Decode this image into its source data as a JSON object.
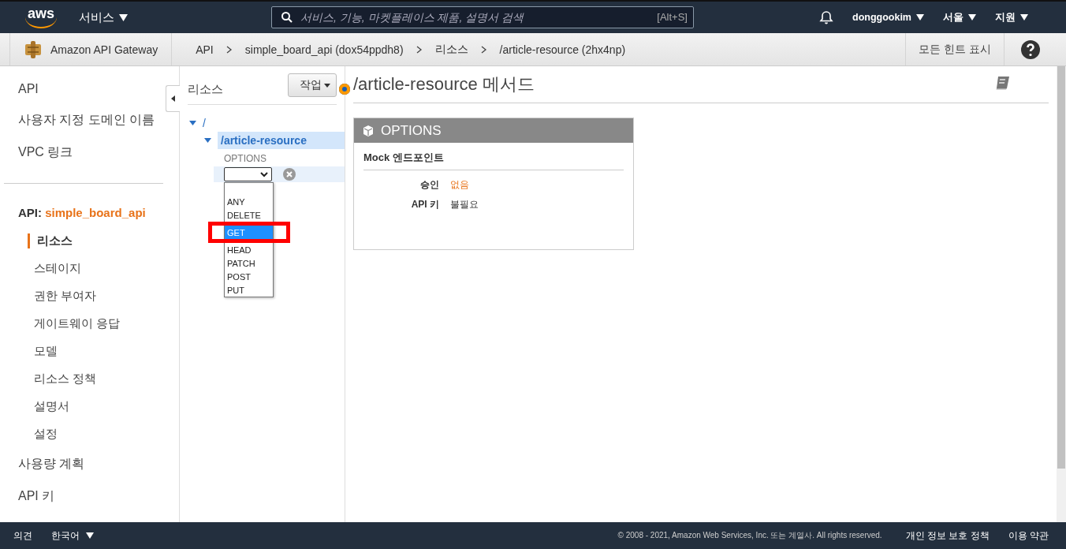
{
  "top_nav": {
    "logo": "aws",
    "services": "서비스",
    "search": {
      "placeholder": "서비스, 기능, 마켓플레이스 제품, 설명서 검색",
      "shortcut": "[Alt+S]"
    },
    "user": "donggookim",
    "region": "서울",
    "support": "지원"
  },
  "breadcrumb": {
    "service": "Amazon API Gateway",
    "items": [
      "API",
      "simple_board_api (dox54ppdh8)",
      "리소스",
      "/article-resource (2hx4np)"
    ],
    "hints": "모든 힌트 표시"
  },
  "sidebar": {
    "top_items": [
      "API",
      "사용자 지정 도메인 이름",
      "VPC 링크"
    ],
    "api_label": "API:",
    "api_name": "simple_board_api",
    "items": [
      {
        "label": "리소스",
        "selected": true
      },
      {
        "label": "스테이지",
        "selected": false
      },
      {
        "label": "권한 부여자",
        "selected": false
      },
      {
        "label": "게이트웨이 응답",
        "selected": false
      },
      {
        "label": "모델",
        "selected": false
      },
      {
        "label": "리소스 정책",
        "selected": false
      },
      {
        "label": "설명서",
        "selected": false
      },
      {
        "label": "설정",
        "selected": false
      }
    ],
    "bottom_items": [
      "사용량 계획",
      "API 키"
    ]
  },
  "resources": {
    "title": "리소스",
    "actions": "작업",
    "root": "/",
    "resource": {
      "path": "/article-resource",
      "selected": true,
      "expanded": true
    },
    "method": "OPTIONS",
    "dropdown": {
      "options": [
        {
          "label": "ANY",
          "selected": false
        },
        {
          "label": "DELETE",
          "selected": false
        },
        {
          "label": "GET",
          "selected": true
        },
        {
          "label": "HEAD",
          "selected": false
        },
        {
          "label": "PATCH",
          "selected": false
        },
        {
          "label": "POST",
          "selected": false
        },
        {
          "label": "PUT",
          "selected": false
        }
      ]
    }
  },
  "content": {
    "title": "/article-resource 메서드",
    "method_card": {
      "title": "OPTIONS",
      "subtitle": "Mock 엔드포인트",
      "rows": [
        {
          "label": "승인",
          "value": "없음",
          "kind": "warning"
        },
        {
          "label": "API 키",
          "value": "불필요",
          "kind": "plain"
        }
      ]
    }
  },
  "footer": {
    "feedback": "의견",
    "language": "한국어",
    "copyright": "© 2008 - 2021, Amazon Web Services, Inc. 또는 계열사. All rights reserved.",
    "links": [
      "개인 정보 보호 정책",
      "이용 약관"
    ]
  }
}
